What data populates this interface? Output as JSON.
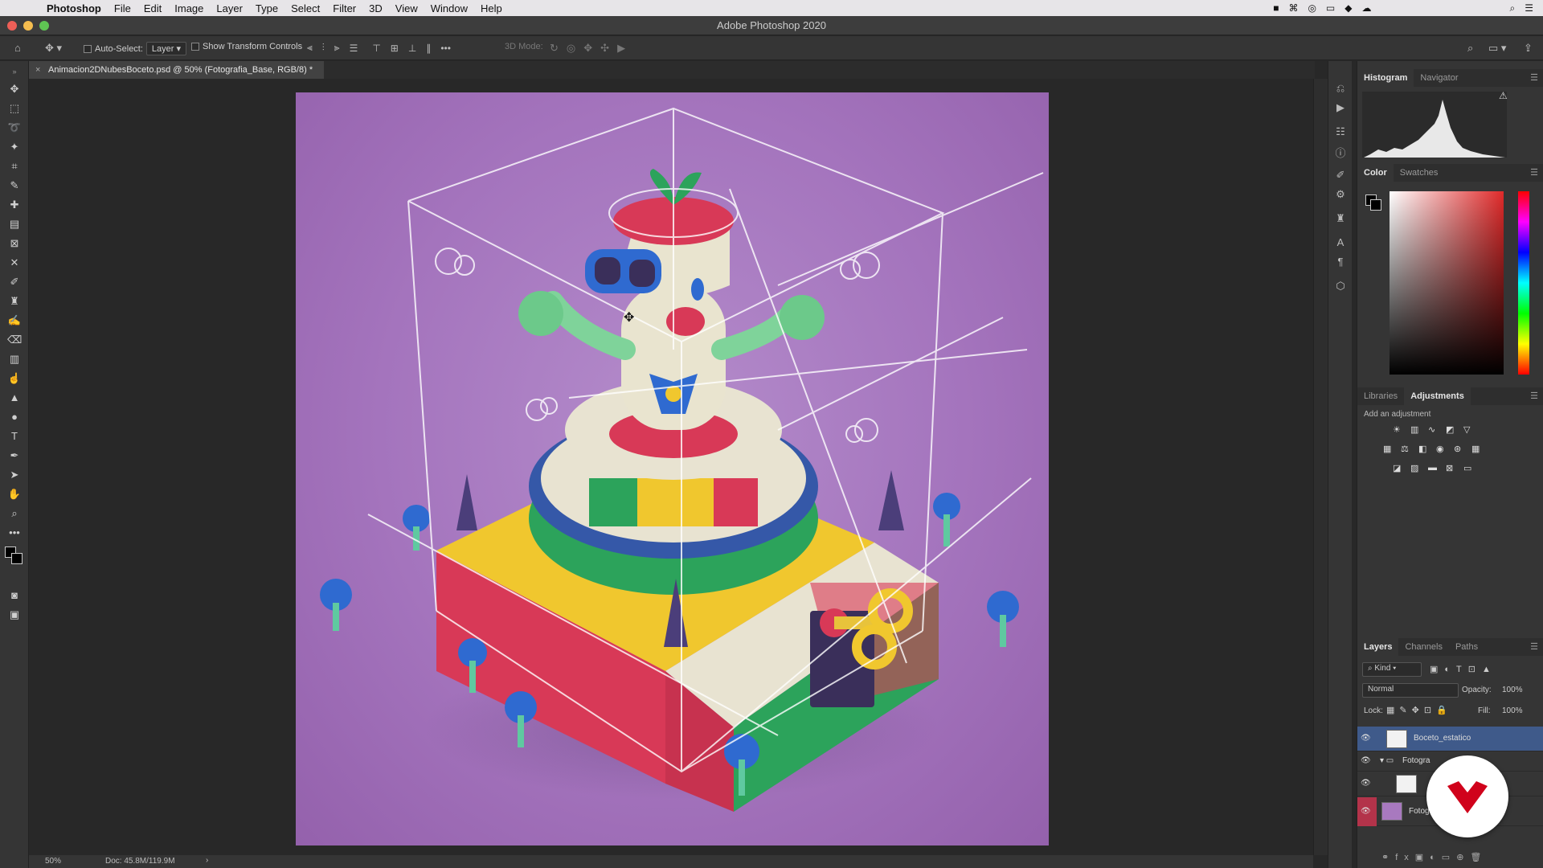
{
  "menubar": {
    "app_name": "Photoshop",
    "items": [
      "File",
      "Edit",
      "Image",
      "Layer",
      "Type",
      "Select",
      "Filter",
      "3D",
      "View",
      "Window",
      "Help"
    ]
  },
  "window": {
    "title": "Adobe Photoshop 2020"
  },
  "options_bar": {
    "auto_select_label": "Auto-Select:",
    "auto_select_value": "Layer",
    "show_transform_label": "Show Transform Controls",
    "mode_3d_label": "3D Mode:"
  },
  "document": {
    "tab_title": "Animacion2DNubesBoceto.psd @ 50% (Fotografia_Base, RGB/8) *",
    "zoom": "50%",
    "doc_size": "Doc: 45.8M/119.9M"
  },
  "panels": {
    "histogram_tabs": [
      "Histogram",
      "Navigator"
    ],
    "color_tabs": [
      "Color",
      "Swatches"
    ],
    "adjust_tabs": [
      "Libraries",
      "Adjustments"
    ],
    "add_adjustment": "Add an adjustment",
    "layers_tabs": [
      "Layers",
      "Channels",
      "Paths"
    ],
    "kind_label": "Kind",
    "blend_mode": "Normal",
    "opacity_label": "Opacity:",
    "opacity_value": "100%",
    "lock_label": "Lock:",
    "fill_label": "Fill:",
    "fill_value": "100%"
  },
  "layers": [
    {
      "name": "Boceto_estatico"
    },
    {
      "name": "Fotogra"
    },
    {
      "name": ""
    },
    {
      "name": "Fotog"
    }
  ],
  "colors": {
    "accent_selected": "#3f5a8a",
    "brand_badge": "#d0021b",
    "canvas_bg": "#a879bf"
  }
}
